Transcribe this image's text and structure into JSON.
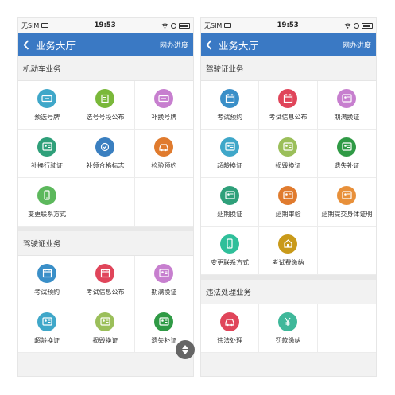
{
  "colors": {
    "navbar": "#3a79c4"
  },
  "left": {
    "status": {
      "carrier": "无SIM",
      "time": "19:53"
    },
    "nav": {
      "title": "业务大厅",
      "action": "网办进度"
    },
    "sections": [
      {
        "title": "机动车业务",
        "items": [
          {
            "label": "预选号牌",
            "icon": "plate-icon",
            "color": "#3fa7c9"
          },
          {
            "label": "选号号段公布",
            "icon": "list-icon",
            "color": "#7ab83a"
          },
          {
            "label": "补换号牌",
            "icon": "plate-replace-icon",
            "color": "#c77fcf"
          },
          {
            "label": "补换行驶证",
            "icon": "license-icon",
            "color": "#2fa07a"
          },
          {
            "label": "补领合格标志",
            "icon": "inspect-badge-icon",
            "color": "#3a7fc0"
          },
          {
            "label": "检验预约",
            "icon": "car-search-icon",
            "color": "#e07b2e"
          },
          {
            "label": "变更联系方式",
            "icon": "phone-icon",
            "color": "#5cb85c"
          }
        ]
      },
      {
        "title": "驾驶证业务",
        "items": [
          {
            "label": "考试预约",
            "icon": "calendar-icon",
            "color": "#3a8fc8"
          },
          {
            "label": "考试信息公布",
            "icon": "calendar-red-icon",
            "color": "#e0455a"
          },
          {
            "label": "期满换证",
            "icon": "renew-icon",
            "color": "#c77fcf"
          },
          {
            "label": "超龄换证",
            "icon": "age-card-icon",
            "color": "#3fa7c9"
          },
          {
            "label": "损毁换证",
            "icon": "damaged-card-icon",
            "color": "#9bbf5a"
          },
          {
            "label": "遗失补证",
            "icon": "lost-card-icon",
            "color": "#2f9a45"
          }
        ]
      }
    ]
  },
  "right": {
    "status": {
      "carrier": "无SIM",
      "time": "19:53"
    },
    "nav": {
      "title": "业务大厅",
      "action": "网办进度"
    },
    "sections": [
      {
        "title": "驾驶证业务",
        "items": [
          {
            "label": "考试预约",
            "icon": "calendar-icon",
            "color": "#3a8fc8"
          },
          {
            "label": "考试信息公布",
            "icon": "calendar-red-icon",
            "color": "#e0455a"
          },
          {
            "label": "期满换证",
            "icon": "renew-icon",
            "color": "#c77fcf"
          },
          {
            "label": "超龄换证",
            "icon": "age-card-icon",
            "color": "#3fa7c9"
          },
          {
            "label": "损毁换证",
            "icon": "damaged-card-icon",
            "color": "#9bbf5a"
          },
          {
            "label": "遗失补证",
            "icon": "lost-card-icon",
            "color": "#2f9a45"
          },
          {
            "label": "延期换证",
            "icon": "extend-card-icon",
            "color": "#2fa07a"
          },
          {
            "label": "延期审验",
            "icon": "extend-review-icon",
            "color": "#e07b2e"
          },
          {
            "label": "延期提交身体证明",
            "icon": "health-cert-icon",
            "color": "#e8903a"
          },
          {
            "label": "变更联系方式",
            "icon": "phone-icon",
            "color": "#2fbf9a"
          },
          {
            "label": "考试费缴纳",
            "icon": "fee-icon",
            "color": "#c99a1a"
          }
        ]
      },
      {
        "title": "违法处理业务",
        "items": [
          {
            "label": "违法处理",
            "icon": "violation-car-icon",
            "color": "#e0455a"
          },
          {
            "label": "罚款缴纳",
            "icon": "yen-icon",
            "color": "#3fb89a"
          }
        ]
      }
    ]
  }
}
